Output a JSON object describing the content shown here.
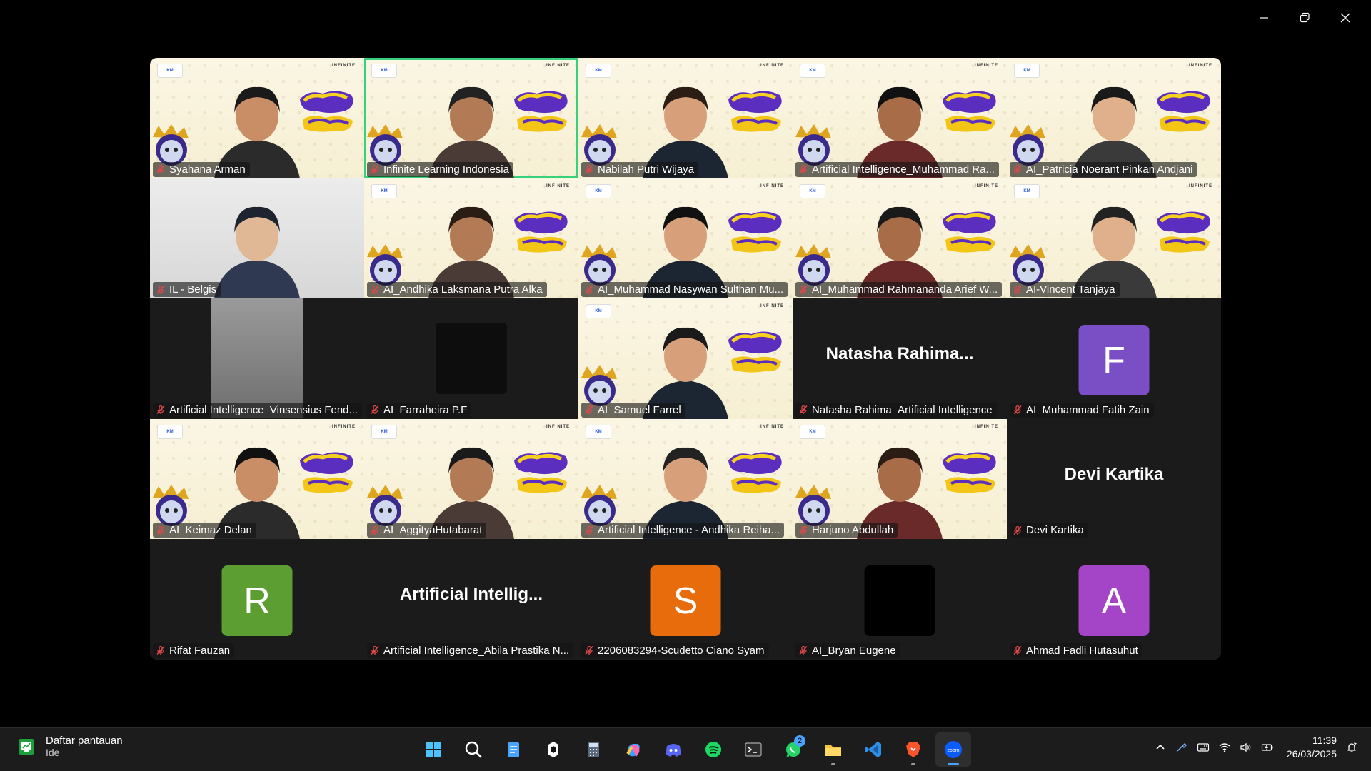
{
  "window": {
    "controls": [
      "minimize",
      "restore",
      "close"
    ]
  },
  "participants": [
    {
      "name": "Syahana Arman",
      "type": "video",
      "muted": true
    },
    {
      "name": "Infinite Learning Indonesia",
      "type": "video",
      "muted": true,
      "speaking": true
    },
    {
      "name": "Nabilah Putri Wijaya",
      "type": "video",
      "muted": true
    },
    {
      "name": "Artificial Intelligence_Muhammad Ra...",
      "type": "video",
      "muted": true
    },
    {
      "name": "AI_Patricia Noerant Pinkan Andjani",
      "type": "video",
      "muted": true
    },
    {
      "name": "IL - Belgis",
      "type": "room",
      "muted": true
    },
    {
      "name": "AI_Andhika Laksmana Putra Alka",
      "type": "video",
      "muted": true
    },
    {
      "name": "AI_Muhammad Nasywan Sulthan Mu...",
      "type": "video",
      "muted": true
    },
    {
      "name": "AI_Muhammad Rahmananda Arief W...",
      "type": "video",
      "muted": true
    },
    {
      "name": "AI-Vincent Tanjaya",
      "type": "video",
      "muted": true
    },
    {
      "name": "Artificial Intelligence_Vinsensius Fend...",
      "type": "darkcam",
      "muted": true
    },
    {
      "name": "AI_Farraheira P.F",
      "type": "space",
      "muted": true
    },
    {
      "name": "AI_Samuel Farrel",
      "type": "video",
      "muted": true
    },
    {
      "name": "Natasha Rahima_Artificial Intelligence",
      "type": "text",
      "big": "Natasha  Rahima...",
      "muted": true
    },
    {
      "name": "AI_Muhammad Fatih Zain",
      "type": "avatar",
      "letter": "F",
      "color": "#7a4fc6",
      "muted": true
    },
    {
      "name": "AI_Keimaz Delan",
      "type": "video",
      "muted": true
    },
    {
      "name": "AI_AggityaHutabarat",
      "type": "video",
      "muted": true
    },
    {
      "name": "Artificial Intelligence - Andhika Reiha...",
      "type": "video",
      "muted": true
    },
    {
      "name": "Harjuno Abdullah",
      "type": "video",
      "muted": true
    },
    {
      "name": "Devi Kartika",
      "type": "text",
      "big": "Devi Kartika",
      "muted": true
    },
    {
      "name": "Rifat Fauzan",
      "type": "avatar",
      "letter": "R",
      "color": "#5d9e32",
      "muted": true
    },
    {
      "name": "Artificial Intelligence_Abila Prastika N...",
      "type": "text",
      "big": "Artificial  Intellig...",
      "muted": true
    },
    {
      "name": "2206083294-Scudetto Ciano Syam",
      "type": "avatar",
      "letter": "S",
      "color": "#e86b0c",
      "muted": true
    },
    {
      "name": "AI_Bryan Eugene",
      "type": "avatar",
      "letter": "",
      "color": "#000000",
      "muted": true
    },
    {
      "name": "Ahmad Fadli Hutasuhut",
      "type": "avatar",
      "letter": "A",
      "color": "#a445c8",
      "muted": true
    }
  ],
  "taskbar": {
    "widget": {
      "title": "Daftar pantauan",
      "subtitle": "Ide"
    },
    "apps": [
      {
        "name": "start-icon"
      },
      {
        "name": "search-icon"
      },
      {
        "name": "notepad-icon"
      },
      {
        "name": "vpn-icon"
      },
      {
        "name": "calculator-icon"
      },
      {
        "name": "copilot-icon"
      },
      {
        "name": "discord-icon"
      },
      {
        "name": "spotify-icon"
      },
      {
        "name": "terminal-icon"
      },
      {
        "name": "whatsapp-icon",
        "badge": "2"
      },
      {
        "name": "file-explorer-icon"
      },
      {
        "name": "vscode-icon"
      },
      {
        "name": "brave-icon"
      },
      {
        "name": "zoom-icon"
      }
    ],
    "clock": {
      "time": "11:39",
      "date": "26/03/2025"
    }
  }
}
